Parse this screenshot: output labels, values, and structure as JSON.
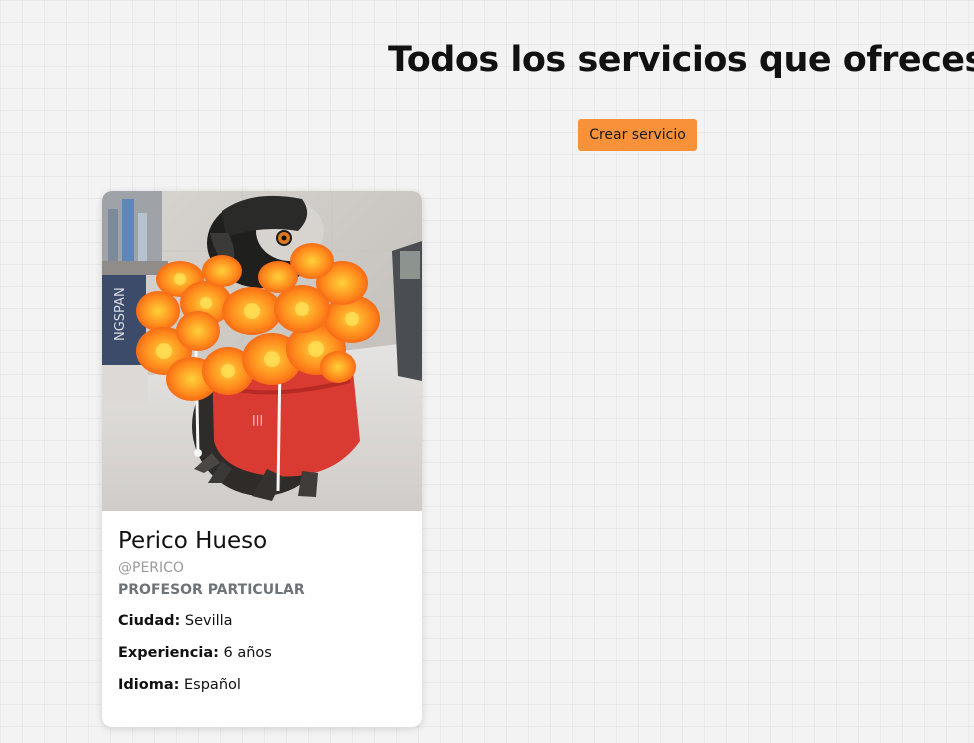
{
  "header": {
    "title": "Todos los servicios que ofreces",
    "create_button_label": "Crear servicio"
  },
  "colors": {
    "accent": "#f7923a",
    "background": "#f3f3f3",
    "card": "#ffffff"
  },
  "services": [
    {
      "image": "parrot-photo",
      "name": "Perico Hueso",
      "username": "@PERICO",
      "role": "PROFESOR PARTICULAR",
      "details": [
        {
          "label": "Ciudad:",
          "value": "Sevilla"
        },
        {
          "label": "Experiencia:",
          "value": "6 años"
        },
        {
          "label": "Idioma:",
          "value": "Español"
        }
      ]
    }
  ]
}
